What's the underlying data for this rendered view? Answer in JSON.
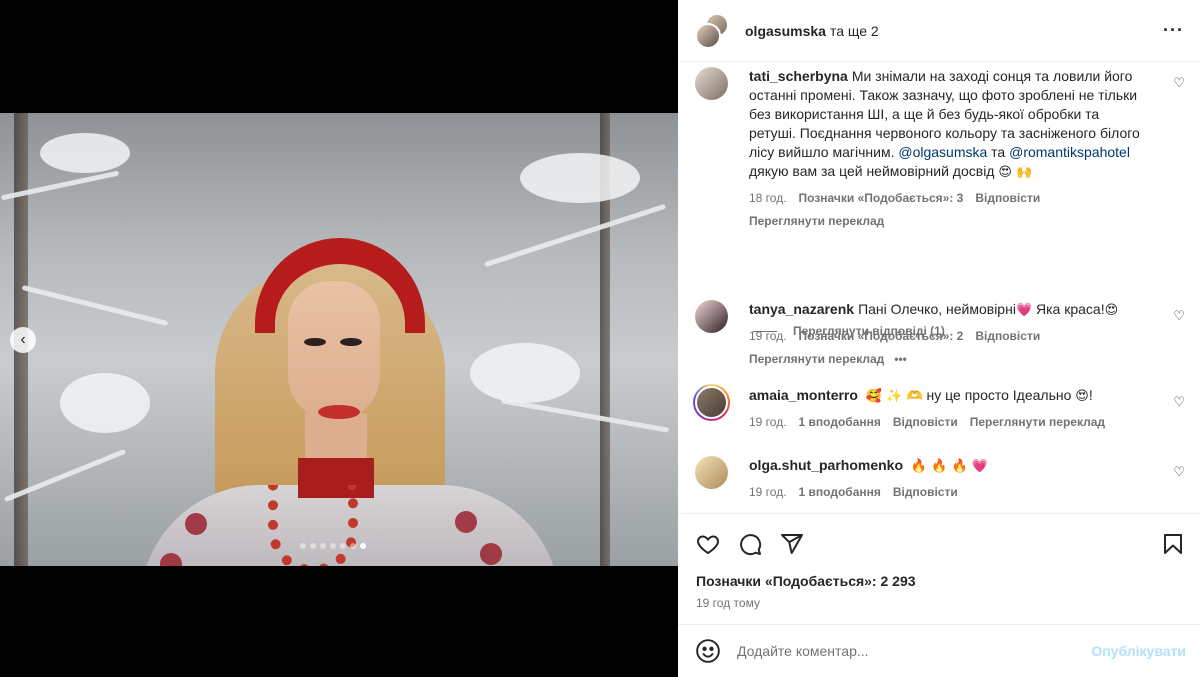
{
  "post": {
    "author": "olgasumska",
    "coauthors_text": "та ще 2",
    "carousel_total": 7,
    "carousel_active": 7
  },
  "comments": [
    {
      "user": "tati_scherbyna",
      "text": "Ми знімали на заході сонця та ловили його останні промені. Також зазначу, що фото зроблені не тільки без використання ШІ, а ще й без будь-якої обробки та ретуші. Поєднання червоного кольору та засніженого білого лісу вийшло магічним.",
      "mention1": "@olgasumska",
      "between": "та",
      "mention2": "@romantikspahotel",
      "tail": "дякую вам за цей неймовірний досвід",
      "emoji": "😍 🙌",
      "time": "18 год.",
      "likes": "Позначки «Подобається»: 3",
      "reply": "Відповісти",
      "translate": "Переглянути переклад"
    },
    {
      "user": "tanya_nazarenk",
      "text": "Пані Олечко, неймовірні",
      "emoji1": "💗",
      "text2": "Яка краса!",
      "emoji2": "😍",
      "time": "19 год.",
      "likes": "Позначки «Подобається»: 2",
      "reply": "Відповісти",
      "translate": "Переглянути переклад",
      "more": "•••"
    },
    {
      "user": "amaia_monterro",
      "emoji1": "🥰 ✨ 🫶",
      "text": "ну це просто Ідеально",
      "emoji2": "😍",
      "tail": "!",
      "time": "19 год.",
      "likes": "1 вподобання",
      "reply": "Відповісти",
      "translate": "Переглянути переклад"
    },
    {
      "user": "olga.shut_parhomenko",
      "emoji": "🔥 🔥 🔥 💗",
      "time": "19 год.",
      "likes": "1 вподобання",
      "reply": "Відповісти"
    }
  ],
  "view_replies": "Переглянути відповіді (1)",
  "likes_total": "Позначки «Подобається»: 2 293",
  "time_ago": "19 год тому",
  "comment_box": {
    "placeholder": "Додайте коментар...",
    "publish": "Опублікувати"
  },
  "icons": {
    "more": "more-horizontal-icon",
    "heart": "heart-icon",
    "comment": "comment-icon",
    "share": "share-icon",
    "bookmark": "bookmark-icon",
    "emoji": "emoji-icon",
    "prev": "chevron-left-icon"
  },
  "colors": {
    "link": "#00376b",
    "muted": "#737373",
    "publish_disabled": "#b2dffc"
  }
}
